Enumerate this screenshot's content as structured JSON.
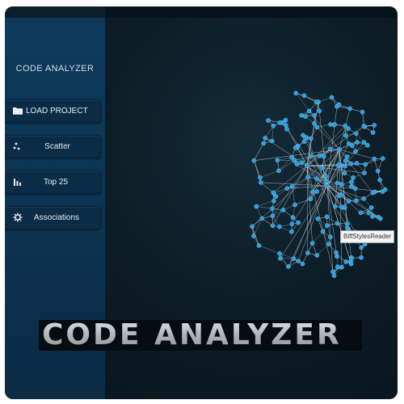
{
  "app": {
    "title": "CODE ANALYZER",
    "banner_title": "CODE ANALYZER",
    "accent_color": "#2a8fd0",
    "sidebar_color": "#0d3a5b",
    "background_color": "#0c1c26"
  },
  "nav": {
    "load_project": {
      "label": "LOAD PROJECT",
      "icon": "folder-icon"
    },
    "scatter": {
      "label": "Scatter",
      "icon": "scatter-icon"
    },
    "top25": {
      "label": "Top 25",
      "icon": "bar-chart-icon"
    },
    "associations": {
      "label": "Associations",
      "icon": "gear-icon"
    }
  },
  "graph": {
    "tooltip": "BiffStylesReader",
    "node_color": "#2aa0e0",
    "edge_color": "#d8e6ee"
  }
}
